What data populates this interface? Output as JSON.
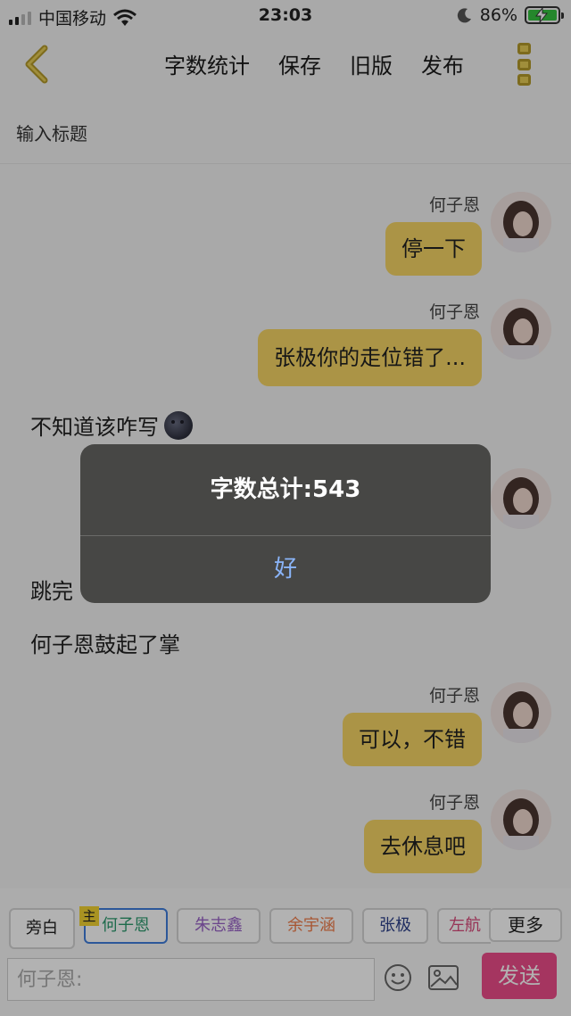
{
  "status_bar": {
    "carrier": "中国移动",
    "time": "23:03",
    "battery": "86%"
  },
  "nav": {
    "actions": [
      "字数统计",
      "保存",
      "旧版",
      "发布"
    ]
  },
  "title_placeholder": "输入标题",
  "messages": [
    {
      "speaker": "何子恩",
      "text": "停一下"
    },
    {
      "speaker": "何子恩",
      "text": "张极你的走位错了..."
    },
    {
      "narration": "不知道该咋写"
    },
    {
      "narration": "跳完"
    },
    {
      "narration": "何子恩鼓起了掌"
    },
    {
      "speaker": "何子恩",
      "text": "可以，不错"
    },
    {
      "speaker": "何子恩",
      "text": "去休息吧"
    }
  ],
  "roles": [
    "旁白",
    "何子恩",
    "朱志鑫",
    "余宇涵",
    "张极",
    "左航"
  ],
  "roles_more": "更多",
  "host_badge": "主",
  "input": {
    "placeholder": "何子恩:",
    "send_label": "发送"
  },
  "dialog": {
    "title": "字数总计:543",
    "ok_label": "好"
  },
  "colors": {
    "bubble": "#f5d565",
    "send": "#ec4c8a",
    "dialog_bg": "#474745",
    "ok_text": "#8ab4f8"
  }
}
